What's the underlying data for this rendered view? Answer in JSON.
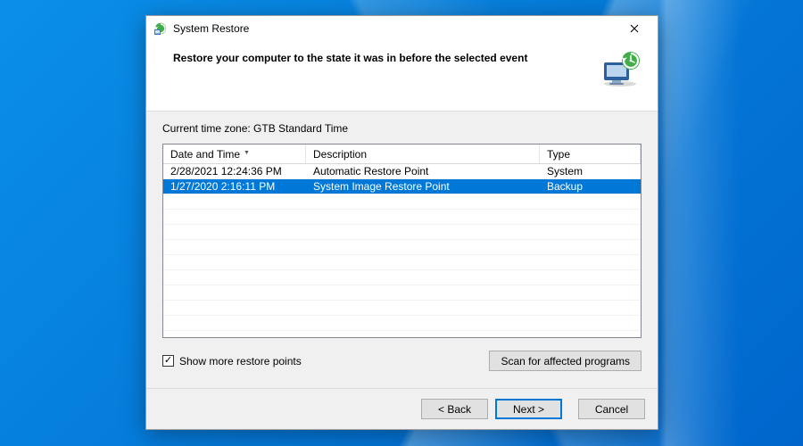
{
  "window": {
    "title": "System Restore",
    "heading": "Restore your computer to the state it was in before the selected event"
  },
  "timezone_label": "Current time zone: GTB Standard Time",
  "columns": {
    "date": "Date and Time",
    "desc": "Description",
    "type": "Type"
  },
  "restore_points": [
    {
      "date": "2/28/2021 12:24:36 PM",
      "desc": "Automatic Restore Point",
      "type": "System",
      "selected": false
    },
    {
      "date": "1/27/2020 2:16:11 PM",
      "desc": "System Image Restore Point",
      "type": "Backup",
      "selected": true
    }
  ],
  "checkbox": {
    "label": "Show more restore points",
    "checked": true
  },
  "buttons": {
    "scan": "Scan for affected programs",
    "back": "< Back",
    "next": "Next >",
    "cancel": "Cancel"
  }
}
